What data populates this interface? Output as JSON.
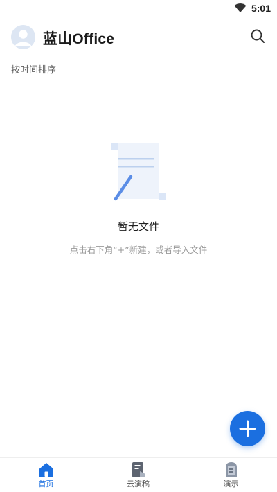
{
  "status_bar": {
    "time": "5:01",
    "wifi_icon": "wifi-icon"
  },
  "header": {
    "title": "蓝山Office",
    "avatar_icon": "avatar-icon",
    "search_icon": "search-icon"
  },
  "sort": {
    "label": "按时间排序"
  },
  "empty_state": {
    "title": "暂无文件",
    "hint": "点击右下角“+”新建，或者导入文件",
    "illustration_icon": "empty-document-icon"
  },
  "fab": {
    "icon": "plus-icon",
    "color": "#1b6fe0"
  },
  "bottom_nav": {
    "items": [
      {
        "label": "首页",
        "icon": "home-icon",
        "active": true
      },
      {
        "label": "云演稿",
        "icon": "cloud-doc-icon",
        "active": false
      },
      {
        "label": "演示",
        "icon": "presentation-icon",
        "active": false
      }
    ]
  },
  "colors": {
    "accent": "#1b6fe0",
    "text": "#1f1f1f",
    "muted": "#9a9a9a"
  }
}
